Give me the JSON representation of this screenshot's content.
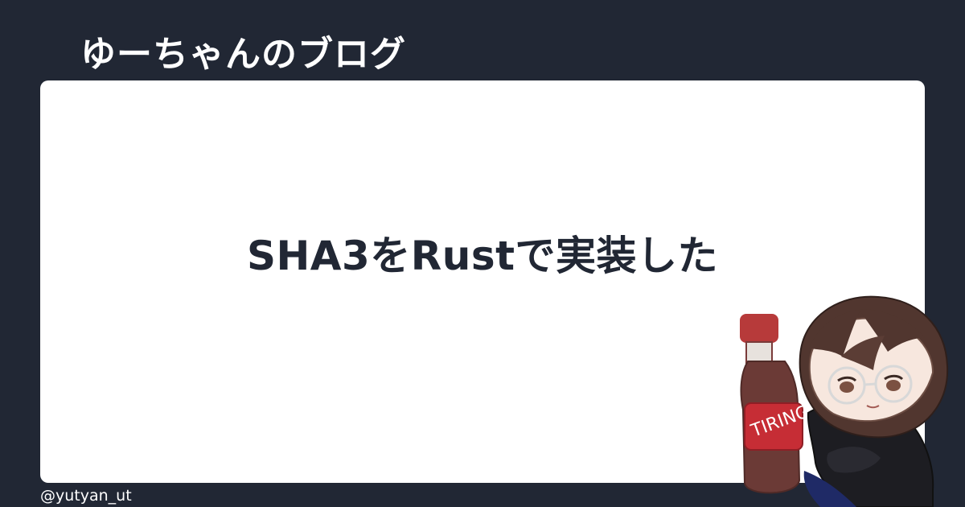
{
  "blog": {
    "title": "ゆーちゃんのブログ"
  },
  "post": {
    "title": "SHA3をRustで実装した"
  },
  "author": {
    "handle": "@yutyan_ut"
  },
  "illustration": {
    "name": "author-mascot-illustration",
    "bottle_label": "TIRING"
  },
  "colors": {
    "background": "#212734",
    "card": "#ffffff",
    "title_text": "#212734",
    "header_text": "#ffffff"
  }
}
